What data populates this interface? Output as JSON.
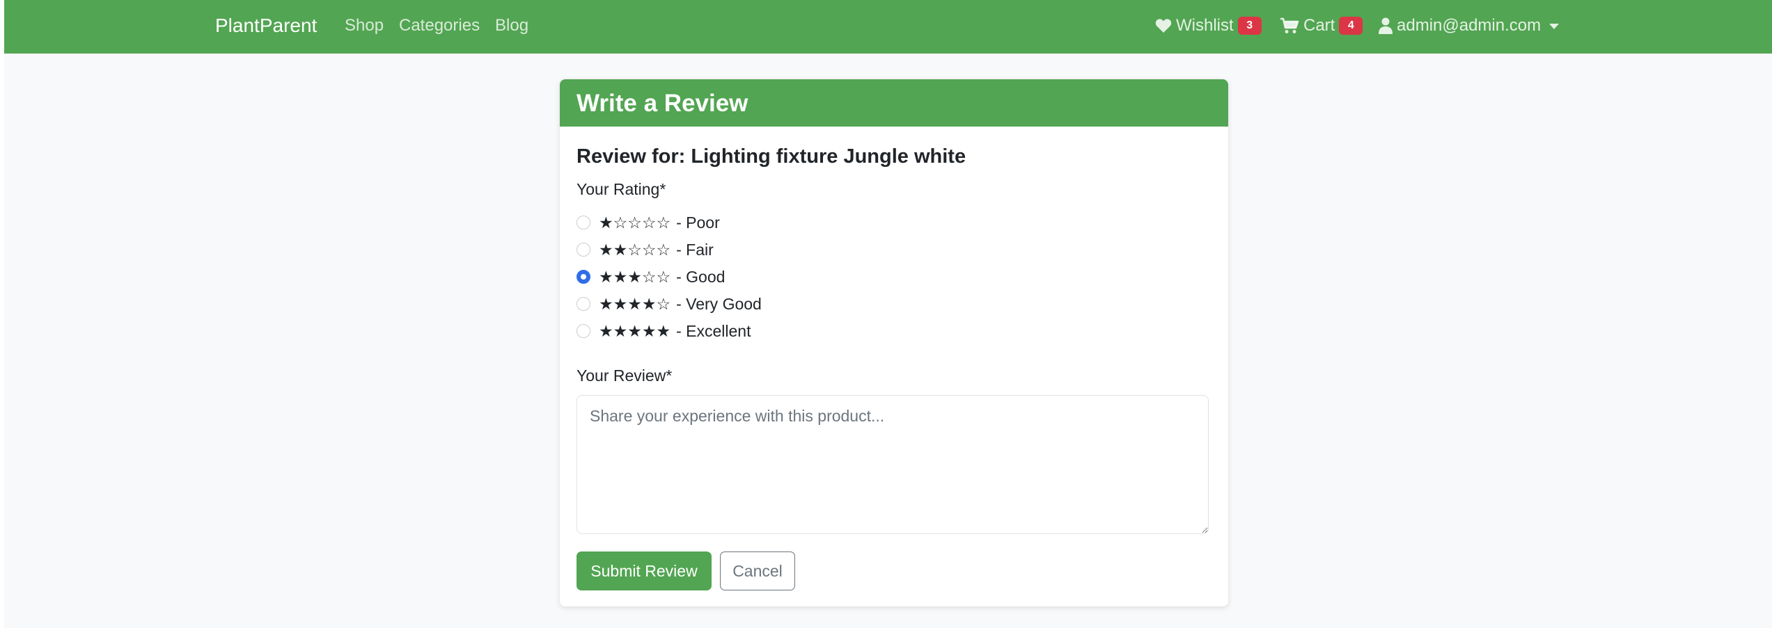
{
  "navbar": {
    "brand": "PlantParent",
    "links": [
      "Shop",
      "Categories",
      "Blog"
    ],
    "wishlist": {
      "label": "Wishlist",
      "count": "3",
      "icon": "heart-icon"
    },
    "cart": {
      "label": "Cart",
      "count": "4",
      "icon": "cart-icon"
    },
    "user": {
      "label": "admin@admin.com",
      "icon": "user-icon"
    }
  },
  "card": {
    "title": "Write a Review",
    "subtitle": "Review for: Lighting fixture Jungle white",
    "rating_label": "Your Rating*",
    "ratings": [
      {
        "stars": "★☆☆☆☆",
        "label": "- Poor",
        "checked": false
      },
      {
        "stars": "★★☆☆☆",
        "label": "- Fair",
        "checked": false
      },
      {
        "stars": "★★★☆☆",
        "label": "- Good",
        "checked": true
      },
      {
        "stars": "★★★★☆",
        "label": "- Very Good",
        "checked": false
      },
      {
        "stars": "★★★★★",
        "label": "- Excellent",
        "checked": false
      }
    ],
    "review_label": "Your Review*",
    "review_placeholder": "Share your experience with this product...",
    "review_value": "",
    "submit_label": "Submit Review",
    "cancel_label": "Cancel"
  },
  "colors": {
    "brand_green": "#52a552",
    "badge_red": "#dc3545",
    "radio_blue": "#2f6ee8",
    "page_bg": "#f8f9fa"
  }
}
